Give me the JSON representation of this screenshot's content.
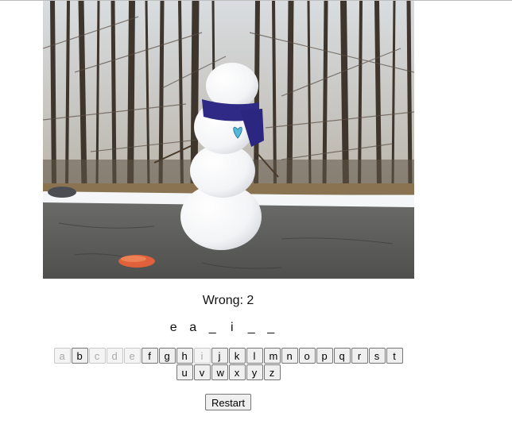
{
  "game": {
    "wrong_label": "Wrong: 2",
    "word_slots": [
      "e",
      "a",
      "_",
      "i",
      "_",
      "_"
    ],
    "restart_label": "Restart"
  },
  "keyboard": {
    "row1": [
      {
        "letter": "a",
        "disabled": true
      },
      {
        "letter": "b",
        "disabled": false
      },
      {
        "letter": "c",
        "disabled": true
      },
      {
        "letter": "d",
        "disabled": true
      },
      {
        "letter": "e",
        "disabled": true
      },
      {
        "letter": "f",
        "disabled": false
      },
      {
        "letter": "g",
        "disabled": false
      },
      {
        "letter": "h",
        "disabled": false
      },
      {
        "letter": "i",
        "disabled": true
      },
      {
        "letter": "j",
        "disabled": false
      },
      {
        "letter": "k",
        "disabled": false
      },
      {
        "letter": "l",
        "disabled": false
      },
      {
        "letter": "m",
        "disabled": false
      },
      {
        "letter": "n",
        "disabled": false
      },
      {
        "letter": "o",
        "disabled": false
      },
      {
        "letter": "p",
        "disabled": false
      },
      {
        "letter": "q",
        "disabled": false
      },
      {
        "letter": "r",
        "disabled": false
      },
      {
        "letter": "s",
        "disabled": false
      },
      {
        "letter": "t",
        "disabled": false
      }
    ],
    "row2": [
      {
        "letter": "u",
        "disabled": false
      },
      {
        "letter": "v",
        "disabled": false
      },
      {
        "letter": "w",
        "disabled": false
      },
      {
        "letter": "x",
        "disabled": false
      },
      {
        "letter": "y",
        "disabled": false
      },
      {
        "letter": "z",
        "disabled": false
      }
    ]
  },
  "image": {
    "subject": "snowman-with-blue-scarf-and-heart"
  },
  "colors": {
    "scarf": "#2e2a86",
    "heart": "#56b7d6",
    "carrot": "#e0603a",
    "asphalt": "#5d5e5c"
  }
}
